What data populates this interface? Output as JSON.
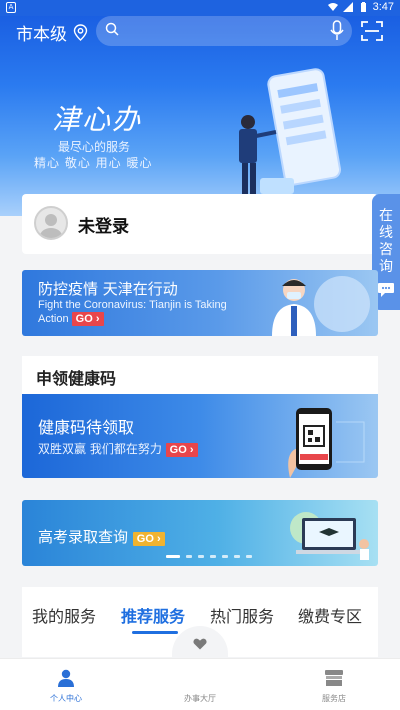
{
  "status_bar": {
    "time": "3:47",
    "left_badge": "A"
  },
  "header": {
    "city": "市本级",
    "brand": "津心办",
    "slogan": "最尽心的服务",
    "values": "精心  敬心  用心  暖心"
  },
  "user": {
    "status": "未登录"
  },
  "consult": {
    "label": "在线咨询"
  },
  "banners": {
    "epidemic": {
      "title": "防控疫情 天津在行动",
      "subtitle": "Fight the Coronavirus: Tianjin is Taking Action",
      "go": "GO"
    },
    "health_code_section": "申领健康码",
    "health_code": {
      "title": "健康码待领取",
      "subtitle": "双胜双赢   我们都在努力",
      "go": "GO"
    },
    "exam": {
      "title": "高考录取查询",
      "go": "GO"
    }
  },
  "service_tabs": [
    {
      "label": "我的服务",
      "active": false
    },
    {
      "label": "推荐服务",
      "active": true
    },
    {
      "label": "热门服务",
      "active": false
    },
    {
      "label": "缴费专区",
      "active": false
    }
  ],
  "bottom_nav": [
    {
      "label": "个人中心",
      "icon": "person-icon",
      "active": true
    },
    {
      "label": "办事大厅",
      "icon": "hall-icon",
      "active": false
    },
    {
      "label": "服务店",
      "icon": "store-icon",
      "active": false
    }
  ],
  "colors": {
    "primary": "#1f6fe0",
    "hero_top": "#1a5fe2",
    "go_red": "#e8464b",
    "go_gold": "#f0b330"
  }
}
